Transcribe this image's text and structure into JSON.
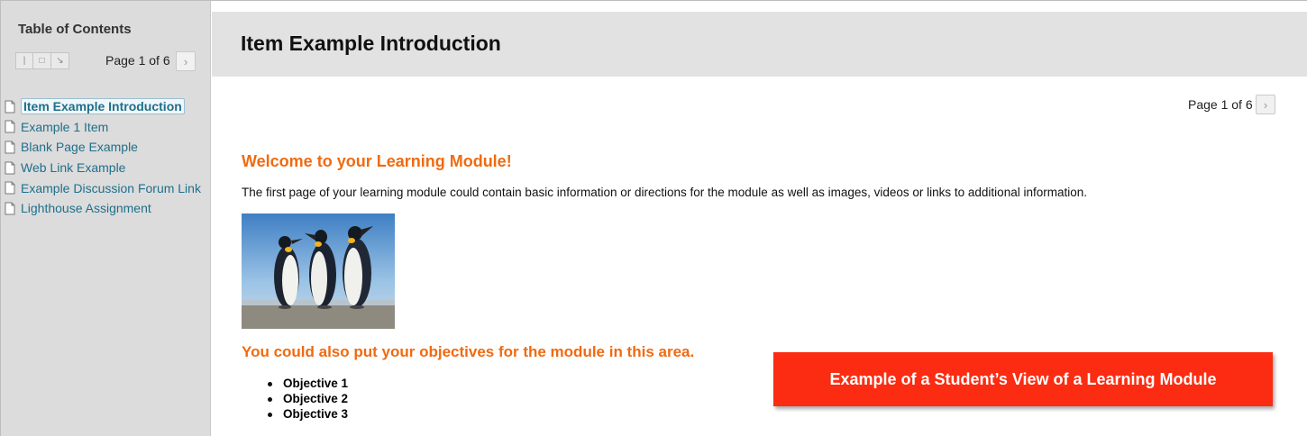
{
  "sidebar": {
    "title": "Table of Contents",
    "page_indicator": "Page 1 of 6",
    "items": [
      {
        "label": "Item Example Introduction",
        "active": true
      },
      {
        "label": "Example 1 Item",
        "active": false
      },
      {
        "label": "Blank Page Example",
        "active": false
      },
      {
        "label": "Web Link Example",
        "active": false
      },
      {
        "label": "Example Discussion Forum Link",
        "active": false
      },
      {
        "label": "Lighthouse Assignment",
        "active": false
      }
    ]
  },
  "header": {
    "title": "Item Example Introduction"
  },
  "main": {
    "page_indicator": "Page 1 of 6",
    "welcome_heading": "Welcome to your Learning Module!",
    "intro_text": "The first page of your learning module could contain basic information or directions for the module as well as images, videos or links to additional information.",
    "objectives_heading": "You could also put your objectives for the module in this area.",
    "objectives": [
      "Objective 1",
      "Objective 2",
      "Objective 3"
    ]
  },
  "callout": {
    "text": "Example of a Student’s View of a Learning Module"
  },
  "colors": {
    "accent_orange": "#f06a10",
    "link_teal": "#1f6f8b",
    "callout_red": "#fb2c12"
  }
}
